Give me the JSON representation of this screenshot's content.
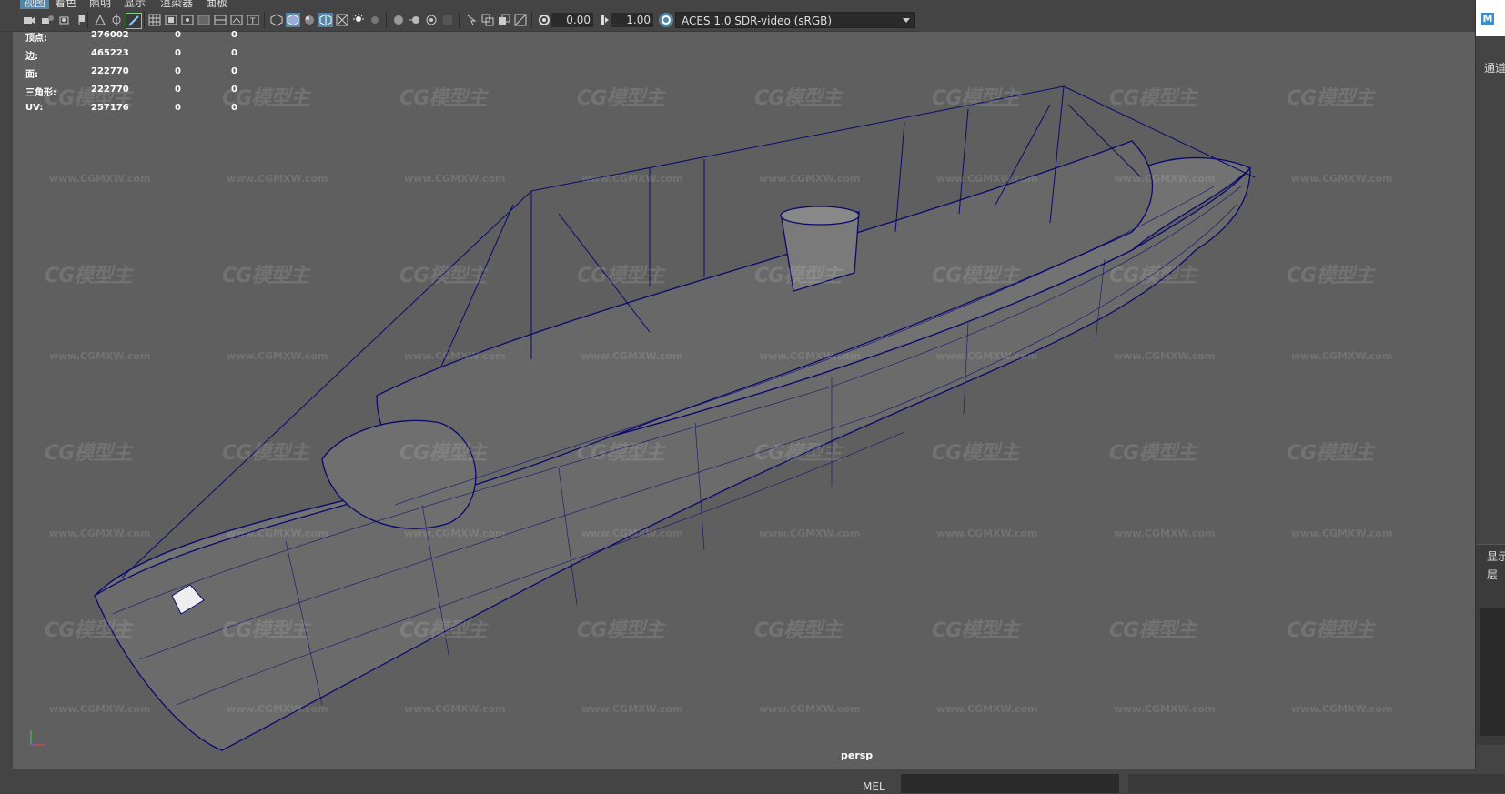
{
  "menubar": {
    "items": [
      "视图",
      "着色",
      "照明",
      "显示",
      "渲染器",
      "面板"
    ]
  },
  "toolbar": {
    "exposure_value": "0.00",
    "gamma_value": "1.00",
    "colorspace": "ACES 1.0 SDR-video (sRGB)"
  },
  "hud": {
    "rows": [
      {
        "label": "顶点:",
        "v1": "276002",
        "v2": "0",
        "v3": "0"
      },
      {
        "label": "边:",
        "v1": "465223",
        "v2": "0",
        "v3": "0"
      },
      {
        "label": "面:",
        "v1": "222770",
        "v2": "0",
        "v3": "0"
      },
      {
        "label": "三角形:",
        "v1": "222770",
        "v2": "0",
        "v3": "0"
      },
      {
        "label": "UV:",
        "v1": "257176",
        "v2": "0",
        "v3": "0"
      }
    ]
  },
  "viewport": {
    "camera_label": "persp"
  },
  "watermark": {
    "logo": "CG模型主",
    "url": "www.CGMXW.com"
  },
  "right_panel": {
    "channel_label": "通道",
    "display_label": "显示",
    "layer_label": "层",
    "app_icon": "M"
  },
  "commandline": {
    "label": "MEL"
  },
  "colors": {
    "wireframe": "#0a0a6e",
    "viewport_bg": "#5f5f5f",
    "hull_shade": "#6a6a6a"
  }
}
